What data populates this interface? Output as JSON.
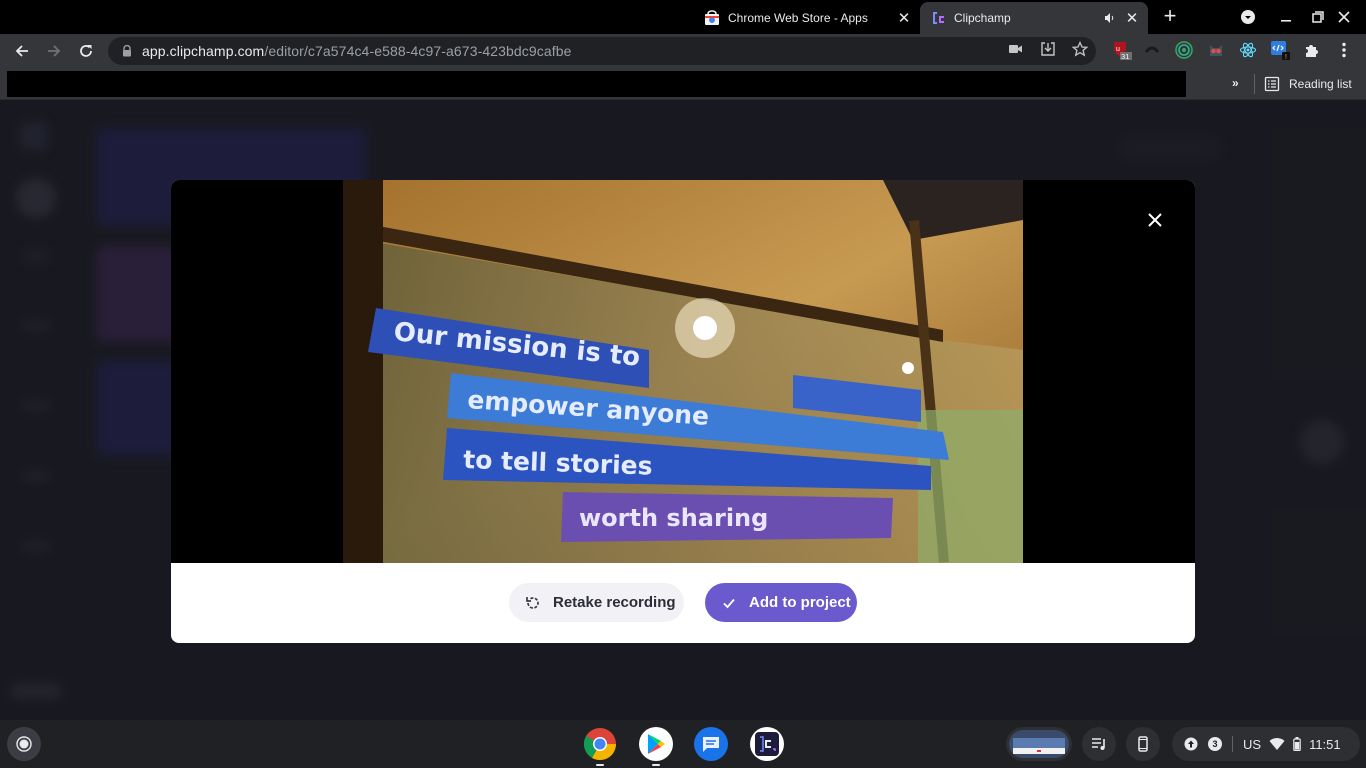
{
  "browser": {
    "tabs": [
      {
        "title": "Chrome Web Store - Apps",
        "active": false,
        "favicon": "chrome-web-store-icon"
      },
      {
        "title": "Clipchamp",
        "active": true,
        "favicon": "clipchamp-icon",
        "audio": true
      }
    ],
    "address_bar": {
      "host": "app.clipchamp.com",
      "path": "/editor/c7a574c4-e588-4c97-a673-423bdc9cafbe"
    },
    "extensions": [
      {
        "name": "ublock-origin",
        "badge": "31"
      },
      {
        "name": "extension-dark"
      },
      {
        "name": "extension-green-target"
      },
      {
        "name": "extension-owl"
      },
      {
        "name": "react-devtools"
      },
      {
        "name": "extension-code",
        "badge": "!"
      }
    ],
    "bookmarks": {
      "overflow_label": "»",
      "reading_list_label": "Reading list"
    }
  },
  "modal": {
    "video_caption_lines": [
      "Our mission is to",
      "empower anyone",
      "to tell stories",
      "worth sharing"
    ],
    "retake_label": "Retake recording",
    "add_label": "Add to project",
    "accent_color": "#6a5acd"
  },
  "shelf": {
    "apps": [
      "Chrome",
      "Play Store",
      "Messages",
      "Clipchamp"
    ],
    "tray": {
      "notification_count": "3",
      "input_method": "US",
      "time": "11:51"
    }
  }
}
